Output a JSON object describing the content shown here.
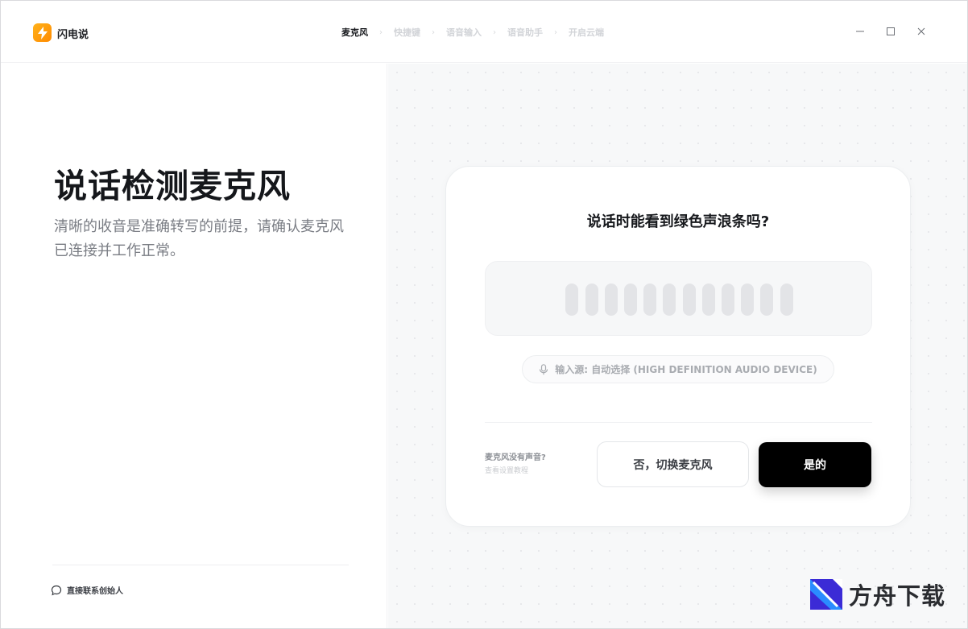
{
  "app": {
    "name": "闪电说"
  },
  "steps": [
    {
      "label": "麦克风",
      "active": true
    },
    {
      "label": "快捷键",
      "active": false
    },
    {
      "label": "语音输入",
      "active": false
    },
    {
      "label": "语音助手",
      "active": false
    },
    {
      "label": "开启云端",
      "active": false
    }
  ],
  "window_controls": {
    "minimize": "—",
    "maximize": "☐",
    "close": "✕"
  },
  "left": {
    "headline": "说话检测麦克风",
    "subtext_line1": "清晰的收音是准确转写的前提，请确认麦克风",
    "subtext_line2": "已连接并工作正常。",
    "contact_label": "直接联系创始人"
  },
  "card": {
    "question": "说话时能看到绿色声浪条吗?",
    "wave_bar_count": 12,
    "source_label": "输入源: 自动选择 (HIGH DEFINITION AUDIO DEVICE)",
    "no_sound_label": "麦克风没有声音?",
    "tutorial_label": "查看设置教程",
    "no_button": "否，切换麦克风",
    "yes_button": "是的"
  },
  "watermark": {
    "text": "方舟下载"
  },
  "colors": {
    "accent": "#ff9d0a",
    "primary_button": "#000000",
    "wave_bar_idle": "#e3e4e7"
  }
}
